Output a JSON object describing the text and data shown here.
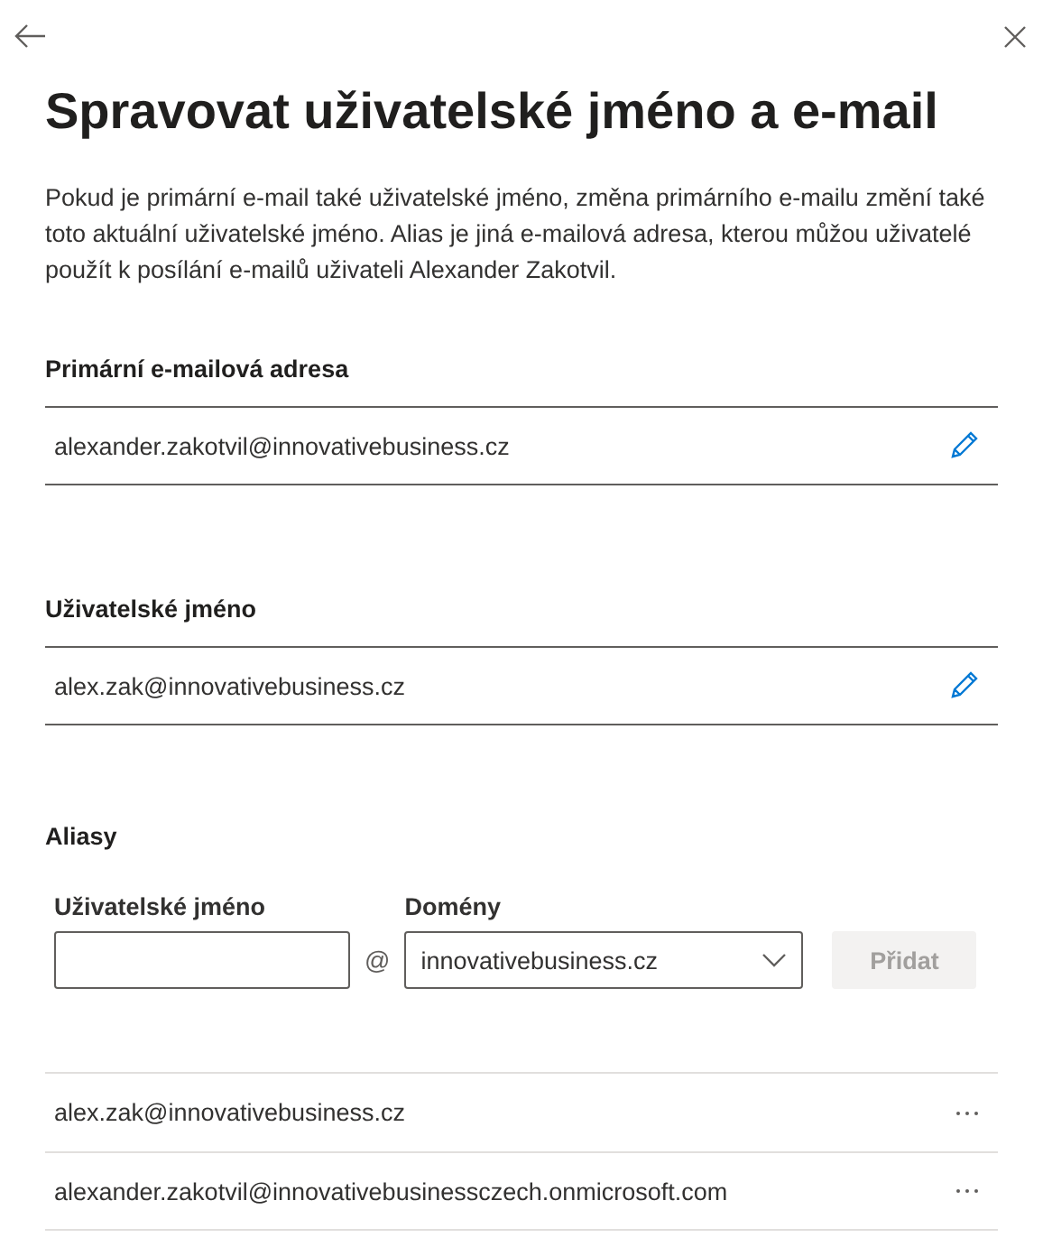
{
  "title": "Spravovat uživatelské jméno a e-mail",
  "description": "Pokud je primární e-mail také uživatelské jméno, změna primárního e-mailu změní také toto aktuální uživatelské jméno. Alias je jiná e-mailová adresa, kterou můžou uživatelé použít k posílání e-mailů uživateli Alexander Zakotvil.",
  "fields": [
    {
      "label": "Primární e-mailová adresa",
      "value": "alexander.zakotvil@innovativebusiness.cz"
    },
    {
      "label": "Uživatelské jméno",
      "value": "alex.zak@innovativebusiness.cz"
    }
  ],
  "aliases": {
    "label": "Aliasy",
    "username_label": "Uživatelské jméno",
    "at": "@",
    "domain_label": "Domény",
    "domain_value": "innovativebusiness.cz",
    "add_button": {
      "label": "Přidat",
      "disabled": true
    },
    "items": [
      "alex.zak@innovativebusiness.cz",
      "alexander.zakotvil@innovativebusinessczech.onmicrosoft.com"
    ]
  }
}
